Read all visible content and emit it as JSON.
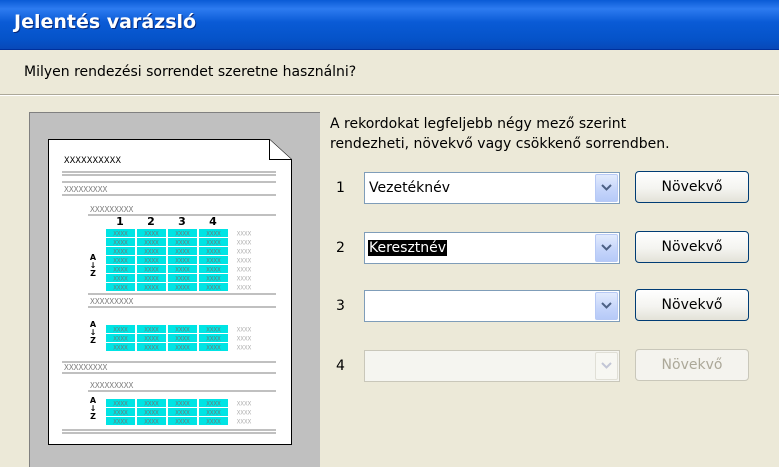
{
  "window": {
    "title": "Jelentés varázsló"
  },
  "question": "Milyen rendezési sorrendet szeretne használni?",
  "info_lines": [
    "A rekordokat legfeljebb négy mező szerint",
    "rendezheti, növekvő vagy csökkenő sorrendben."
  ],
  "sort_rows": [
    {
      "number": "1",
      "field": "Vezetéknév",
      "order_label": "Növekvő",
      "enabled": true,
      "selected": false
    },
    {
      "number": "2",
      "field": "Keresztnév",
      "order_label": "Növekvő",
      "enabled": true,
      "selected": true
    },
    {
      "number": "3",
      "field": "",
      "order_label": "Növekvő",
      "enabled": true,
      "selected": false
    },
    {
      "number": "4",
      "field": "",
      "order_label": "Növekvő",
      "enabled": false,
      "selected": false
    }
  ],
  "preview": {
    "title_placeholder": "XXXXXXXXXX",
    "group_placeholder": "XXXXXXXXX",
    "cell_text": "XXXX",
    "column_numbers": [
      "1",
      "2",
      "3",
      "4"
    ],
    "sort_glyph": [
      "A",
      "↓",
      "Z"
    ],
    "highlight_color": "#00E4E4"
  },
  "colors": {
    "title_bar": "#0A5BD6",
    "dialog_bg": "#ECE9D8",
    "preview_bg": "#C0C0C0"
  }
}
